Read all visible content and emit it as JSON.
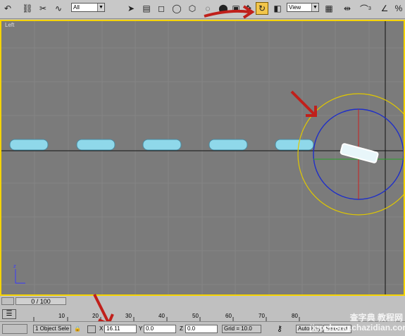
{
  "toolbar": {
    "selection_filter": "All",
    "ref_coord": "View",
    "snap_count": "3",
    "icons": [
      "undo-icon",
      "link-icon",
      "unlink-icon",
      "bind-spacewarp-icon",
      "select-icon",
      "select-by-name-icon",
      "rect-region-icon",
      "circle-region-icon",
      "fence-region-icon",
      "lasso-region-icon",
      "paint-region-icon",
      "window-crossing-icon",
      "move-icon",
      "rotate-icon",
      "scale-icon",
      "pivot-icon",
      "mirror-icon",
      "snap-icon",
      "angle-snap-icon"
    ]
  },
  "viewport": {
    "label": "Left"
  },
  "timeline": {
    "slider_label": "0 / 100",
    "ticks": [
      "10",
      "20",
      "30",
      "40",
      "50",
      "60",
      "70",
      "80"
    ]
  },
  "status": {
    "selection_text": "1 Object Sele",
    "x_label": "X",
    "x_value": "16.11",
    "y_label": "Y",
    "y_value": "0.0",
    "z_label": "Z",
    "z_value": "0.0",
    "grid": "Grid = 10.0",
    "auto_key": "Auto Key",
    "selected": "Selected"
  },
  "watermark": "查字典 教程网 jiaocheng.chazidian.com",
  "colors": {
    "active_button": "#f3c64a",
    "viewport_bg": "#7b7b7b",
    "viewport_border": "#f5d300",
    "gizmo_blue": "#1f2fc8",
    "gizmo_yellow": "#e0c800",
    "arrow_red": "#c0201b"
  }
}
